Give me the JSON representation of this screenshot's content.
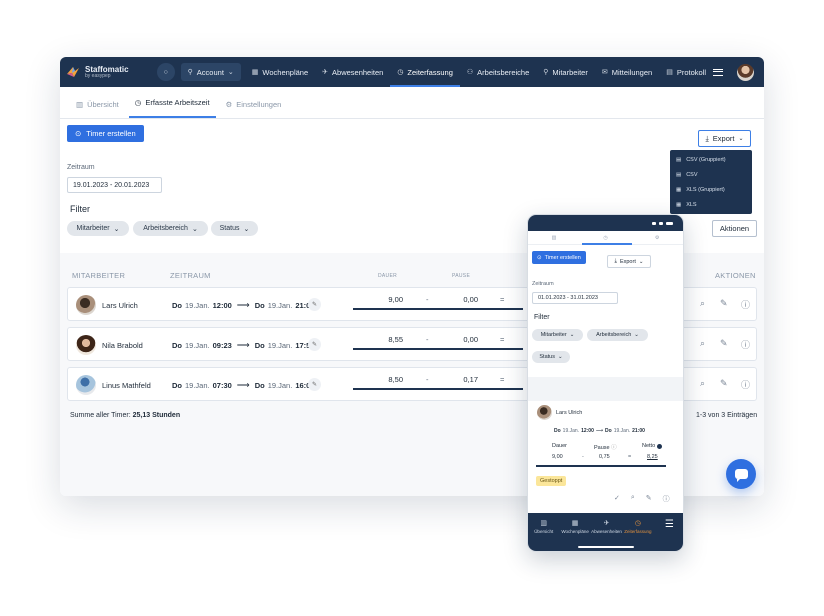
{
  "app": {
    "name": "Staffomatic",
    "tagline": "by easypep"
  },
  "nav": {
    "account": "Account",
    "items": [
      {
        "label": "Wochenpläne",
        "icon": "calendar-icon"
      },
      {
        "label": "Abwesenheiten",
        "icon": "plane-icon"
      },
      {
        "label": "Zeiterfassung",
        "icon": "clock-icon",
        "active": true
      },
      {
        "label": "Arbeitsbereiche",
        "icon": "network-icon"
      },
      {
        "label": "Mitarbeiter",
        "icon": "user-icon"
      },
      {
        "label": "Mitteilungen",
        "icon": "mail-icon"
      },
      {
        "label": "Protokoll",
        "icon": "document-icon"
      }
    ]
  },
  "subtabs": [
    {
      "label": "Übersicht"
    },
    {
      "label": "Erfasste Arbeitszeit",
      "active": true
    },
    {
      "label": "Einstellungen"
    }
  ],
  "toolbar": {
    "timer_button": "Timer erstellen",
    "export_button": "Export"
  },
  "export_menu": [
    "CSV (Gruppiert)",
    "CSV",
    "XLS (Gruppiert)",
    "XLS"
  ],
  "period": {
    "label": "Zeitraum",
    "value": "19.01.2023 - 20.01.2023"
  },
  "filter": {
    "title": "Filter",
    "chips": [
      "Mitarbeiter",
      "Arbeitsbereich",
      "Status"
    ],
    "actions_button": "Aktionen"
  },
  "table": {
    "headers": {
      "employee": "MITARBEITER",
      "period": "ZEITRAUM",
      "duration": "DAUER",
      "pause": "PAUSE",
      "actions": "AKTIONEN"
    },
    "rows": [
      {
        "name": "Lars Ulrich",
        "from_day": "Do",
        "from_date": "19.Jan.",
        "from_time": "12:00",
        "to_day": "Do",
        "to_date": "19.Jan.",
        "to_time": "21:00",
        "duration": "9,00",
        "minus": "-",
        "pause": "0,00",
        "eq": "="
      },
      {
        "name": "Nila Brabold",
        "from_day": "Do",
        "from_date": "19.Jan.",
        "from_time": "09:23",
        "to_day": "Do",
        "to_date": "19.Jan.",
        "to_time": "17:56",
        "duration": "8,55",
        "minus": "-",
        "pause": "0,00",
        "eq": "="
      },
      {
        "name": "Linus Mathfeld",
        "from_day": "Do",
        "from_date": "19.Jan.",
        "from_time": "07:30",
        "to_day": "Do",
        "to_date": "19.Jan.",
        "to_time": "16:00",
        "duration": "8,50",
        "minus": "-",
        "pause": "0,17",
        "eq": "="
      }
    ]
  },
  "summary": {
    "label": "Summe aller Timer:",
    "value": "25,13 Stunden",
    "range": "1-3 von 3 Einträgen"
  },
  "mobile": {
    "timer_button": "Timer erstellen",
    "export_button": "Export",
    "period_label": "Zeitraum",
    "period_value": "01.01.2023 - 31.01.2023",
    "filter_title": "Filter",
    "chips": [
      "Mitarbeiter",
      "Arbeitsbereich",
      "Status"
    ],
    "card": {
      "name": "Lars Ulrich",
      "from_day": "Do",
      "from_date": "19.Jan.",
      "from_time": "12:00",
      "to_day": "Do",
      "to_date": "19.Jan.",
      "to_time": "21:00",
      "h_duration": "Dauer",
      "h_pause": "Pause",
      "h_net": "Netto",
      "duration": "9,00",
      "minus": "-",
      "pause": "0,75",
      "eq": "=",
      "net": "8,25",
      "status": "Gestoppt"
    },
    "bottom_nav": [
      {
        "label": "Übersicht"
      },
      {
        "label": "Wochenpläne"
      },
      {
        "label": "Abwesenheiten"
      },
      {
        "label": "Zeiterfassung",
        "active": true
      }
    ]
  },
  "colors": {
    "navy": "#1e3350",
    "accent": "#2f6fe0",
    "active_nav_mobile": "#e0913f",
    "badge": "#fbe69a"
  }
}
